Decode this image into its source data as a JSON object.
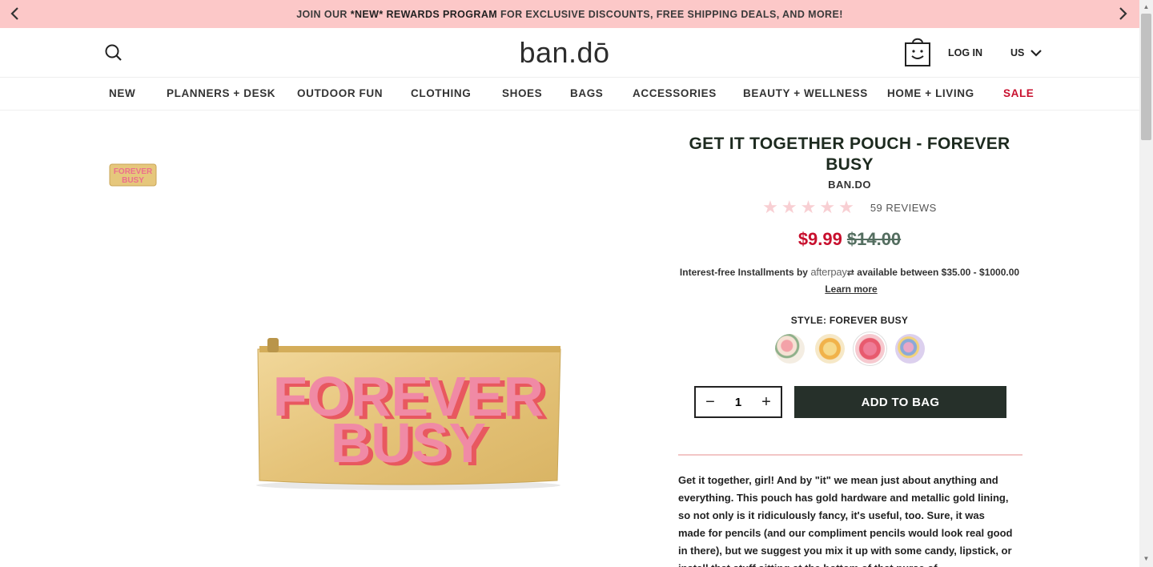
{
  "promo": {
    "prefix": "JOIN OUR ",
    "highlight": "*NEW* REWARDS PROGRAM",
    "suffix": " FOR EXCLUSIVE DISCOUNTS, FREE SHIPPING DEALS, AND MORE!"
  },
  "header": {
    "logo": "ban.dō",
    "login": "LOG IN",
    "locale": "US"
  },
  "nav": {
    "items": [
      "NEW",
      "PLANNERS + DESK",
      "OUTDOOR FUN",
      "CLOTHING",
      "SHOES",
      "BAGS",
      "ACCESSORIES",
      "BEAUTY + WELLNESS",
      "HOME + LIVING",
      "SALE"
    ]
  },
  "product": {
    "title": "GET IT TOGETHER POUCH - FOREVER BUSY",
    "brand": "BAN.DO",
    "rating": 0,
    "reviews": "59 REVIEWS",
    "sale_price": "$9.99",
    "original_price": "$14.00",
    "afterpay": {
      "prefix": "Interest-free Installments by",
      "brandmark": "afterpay",
      "range": "available between $35.00 - $1000.00",
      "learn_more": "Learn more"
    },
    "style_label": "STYLE: FOREVER BUSY",
    "swatches": [
      "floral",
      "stay fun",
      "forever busy",
      "floral multi"
    ],
    "quantity": "1",
    "add_to_bag": "ADD TO BAG",
    "image_text": [
      "FOREVER",
      "BUSY"
    ],
    "description": "Get it together, girl! And by \"it\" we mean just about anything and everything. This pouch has gold hardware and metallic gold lining, so not only is it ridiculously fancy, it's useful, too. Sure, it was made for pencils (and our compliment pencils would look real good in there), but we suggest you mix it up with some candy, lipstick, or install that stuff sitting at the bottom of that purse of"
  },
  "colors": {
    "promo_bg": "#fcc8c8",
    "sale": "#c8102e",
    "button": "#26302a",
    "star": "#f8cfd3"
  }
}
